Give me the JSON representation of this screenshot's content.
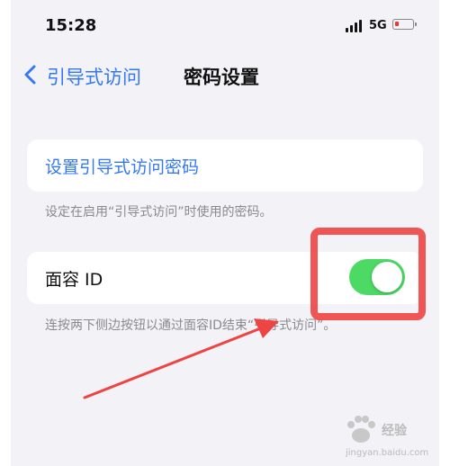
{
  "status_bar": {
    "time": "15:28",
    "network": "5G"
  },
  "nav": {
    "back_label": "引导式访问",
    "title": "密码设置"
  },
  "passcode_section": {
    "link_label": "设置引导式访问密码",
    "footer": "设定在启用“引导式访问”时使用的密码。"
  },
  "faceid_section": {
    "label": "面容 ID",
    "toggle_on": true,
    "footer": "连按两下侧边按钮以通过面容ID结束“引导式访问”。"
  },
  "colors": {
    "accent": "#3478f6",
    "toggle_on": "#4cd964",
    "annotation": "#ef4444",
    "battery_low": "#e53935"
  },
  "watermark": {
    "text": "经验",
    "url": "jingyan.baidu.com"
  }
}
